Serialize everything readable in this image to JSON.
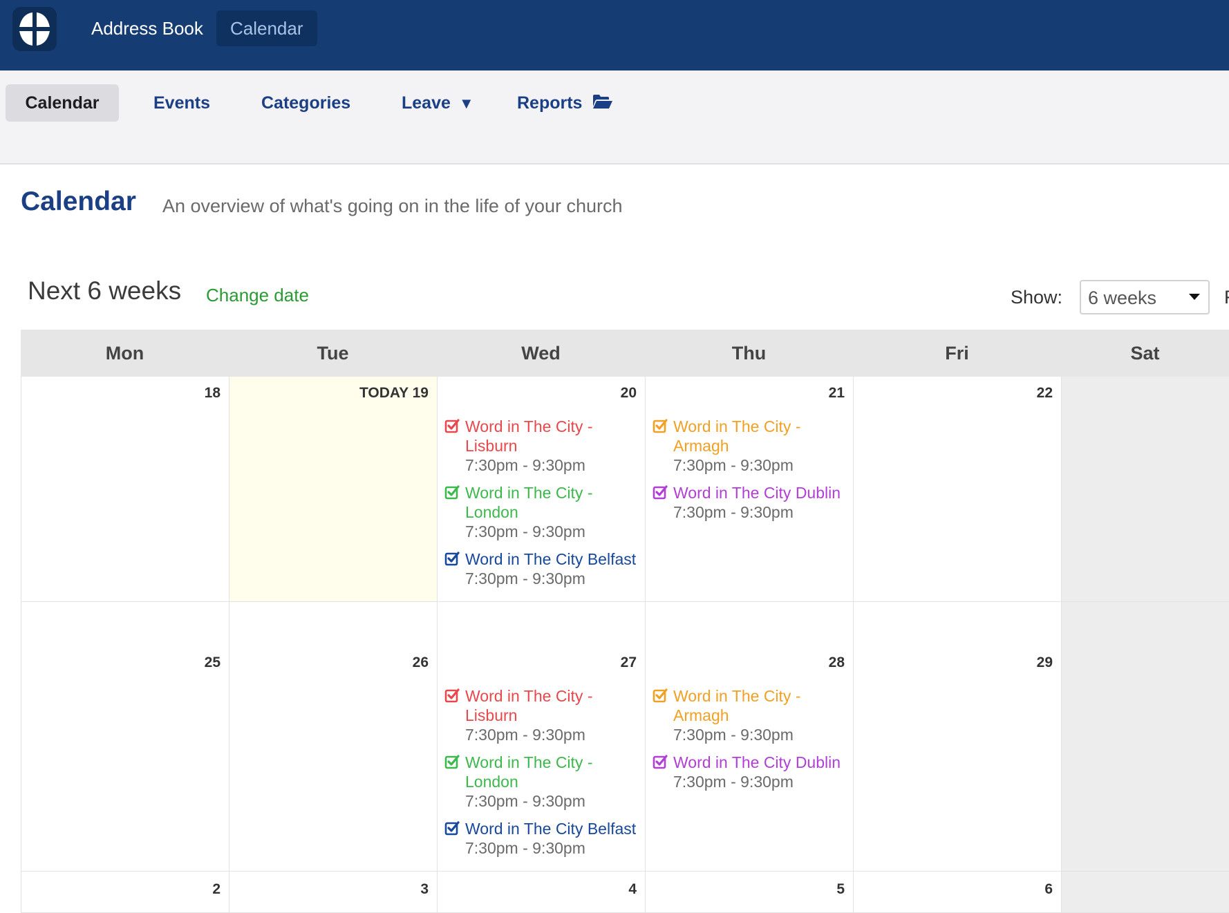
{
  "topnav": {
    "items": [
      "Address Book",
      "Calendar"
    ],
    "active": "Calendar"
  },
  "subnav": {
    "items": [
      "Calendar",
      "Events",
      "Categories",
      "Leave",
      "Reports"
    ],
    "leave_caret": "▼"
  },
  "page": {
    "title": "Calendar",
    "subtitle": "An overview of what's going on in the life of your church"
  },
  "range": {
    "title": "Next 6 weeks",
    "change_link": "Change date"
  },
  "show": {
    "label": "Show:",
    "value": "6 weeks",
    "trailing": "F"
  },
  "colors": {
    "red": "#e8484b",
    "green": "#3cb84c",
    "blue": "#17489a",
    "orange": "#f2a023",
    "purple": "#b13ed6"
  },
  "calendar": {
    "day_headers": [
      "Mon",
      "Tue",
      "Wed",
      "Thu",
      "Fri",
      "Sat"
    ],
    "weeks": [
      {
        "days": [
          {
            "label": "18",
            "events": []
          },
          {
            "label": "TODAY 19",
            "today": true,
            "events": []
          },
          {
            "label": "20",
            "events": [
              {
                "title": "Word in The City - Lisburn",
                "time": "7:30pm - 9:30pm",
                "color": "red"
              },
              {
                "title": "Word in The City - London",
                "time": "7:30pm - 9:30pm",
                "color": "green"
              },
              {
                "title": "Word in The City Belfast",
                "time": "7:30pm - 9:30pm",
                "color": "blue"
              }
            ]
          },
          {
            "label": "21",
            "events": [
              {
                "title": "Word in The City - Armagh",
                "time": "7:30pm - 9:30pm",
                "color": "orange"
              },
              {
                "title": "Word in The City Dublin",
                "time": "7:30pm - 9:30pm",
                "color": "purple"
              }
            ]
          },
          {
            "label": "22",
            "events": []
          },
          {
            "label": "",
            "events": []
          }
        ]
      },
      {
        "days": [
          {
            "label": "25",
            "events": []
          },
          {
            "label": "26",
            "events": []
          },
          {
            "label": "27",
            "events": [
              {
                "title": "Word in The City - Lisburn",
                "time": "7:30pm - 9:30pm",
                "color": "red"
              },
              {
                "title": "Word in The City - London",
                "time": "7:30pm - 9:30pm",
                "color": "green"
              },
              {
                "title": "Word in The City Belfast",
                "time": "7:30pm - 9:30pm",
                "color": "blue"
              }
            ]
          },
          {
            "label": "28",
            "events": [
              {
                "title": "Word in The City - Armagh",
                "time": "7:30pm - 9:30pm",
                "color": "orange"
              },
              {
                "title": "Word in The City Dublin",
                "time": "7:30pm - 9:30pm",
                "color": "purple"
              }
            ]
          },
          {
            "label": "29",
            "events": []
          },
          {
            "label": "",
            "events": []
          }
        ]
      },
      {
        "days": [
          {
            "label": "2",
            "events": []
          },
          {
            "label": "3",
            "events": []
          },
          {
            "label": "4",
            "events": []
          },
          {
            "label": "5",
            "events": []
          },
          {
            "label": "6",
            "events": []
          },
          {
            "label": "",
            "events": []
          }
        ]
      }
    ]
  }
}
